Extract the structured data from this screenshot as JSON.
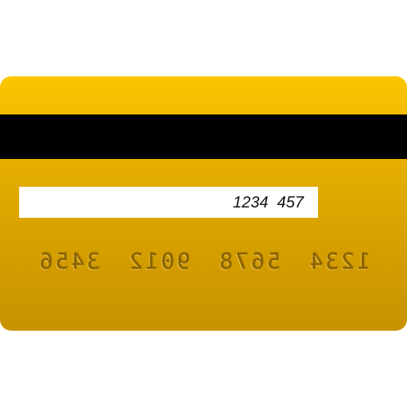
{
  "card": {
    "back_color": "#e8b000",
    "stripe_color": "#000000",
    "security_code": "1234  457",
    "embossed_number": "1234 5678 9012 3456"
  }
}
